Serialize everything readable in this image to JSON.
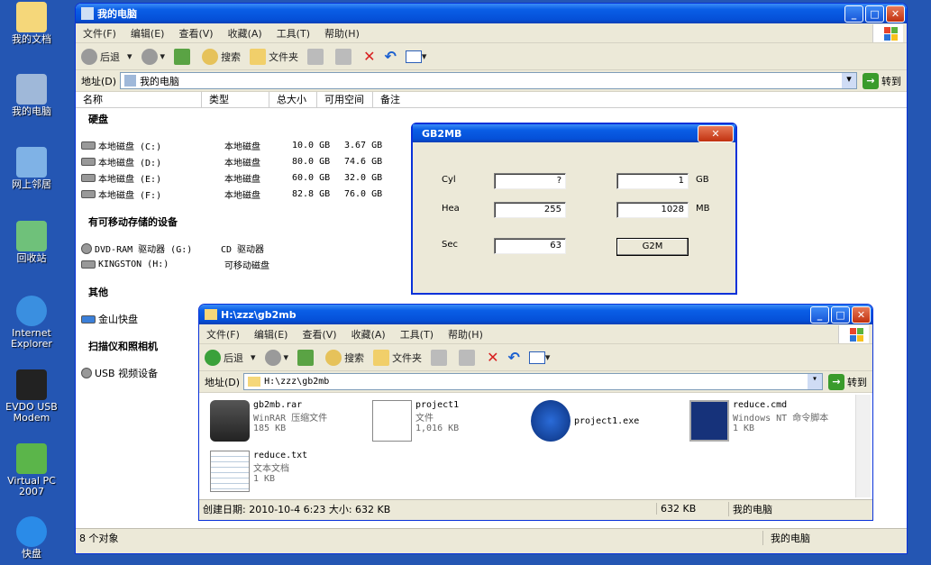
{
  "desktop": {
    "icons": [
      {
        "label": "我的文档"
      },
      {
        "label": "我的电脑"
      },
      {
        "label": "网上邻居"
      },
      {
        "label": "回收站"
      },
      {
        "label": "Internet Explorer"
      },
      {
        "label": "EVDO USB Modem"
      },
      {
        "label": "Virtual PC 2007"
      },
      {
        "label": "快盘"
      }
    ]
  },
  "main": {
    "title": "我的电脑",
    "menu": [
      "文件(F)",
      "编辑(E)",
      "查看(V)",
      "收藏(A)",
      "工具(T)",
      "帮助(H)"
    ],
    "toolbar": {
      "back": "后退",
      "search": "搜索",
      "folders": "文件夹"
    },
    "address": {
      "label": "地址(D)",
      "value": "我的电脑",
      "go": "转到"
    },
    "columns": [
      "名称",
      "类型",
      "总大小",
      "可用空间",
      "备注"
    ],
    "groups": {
      "hdd": "硬盘",
      "removable": "有可移动存储的设备",
      "other": "其他",
      "scanner": "扫描仪和照相机"
    },
    "drives": [
      {
        "name": "本地磁盘 (C:)",
        "type": "本地磁盘",
        "total": "10.0 GB",
        "free": "3.67 GB"
      },
      {
        "name": "本地磁盘 (D:)",
        "type": "本地磁盘",
        "total": "80.0 GB",
        "free": "74.6 GB"
      },
      {
        "name": "本地磁盘 (E:)",
        "type": "本地磁盘",
        "total": "60.0 GB",
        "free": "32.0 GB"
      },
      {
        "name": "本地磁盘 (F:)",
        "type": "本地磁盘",
        "total": "82.8 GB",
        "free": "76.0 GB"
      }
    ],
    "removable": [
      {
        "name": "DVD-RAM 驱动器 (G:)",
        "type": "CD 驱动器"
      },
      {
        "name": "KINGSTON (H:)",
        "type": "可移动磁盘"
      }
    ],
    "other": [
      {
        "name": "金山快盘"
      }
    ],
    "scanner": [
      {
        "name": "USB 视频设备"
      }
    ],
    "status": {
      "count": "8 个对象",
      "location": "我的电脑"
    }
  },
  "dialog": {
    "title": "GB2MB",
    "labels": {
      "cyl": "Cyl",
      "hea": "Hea",
      "sec": "Sec",
      "gb": "GB",
      "mb": "MB"
    },
    "values": {
      "cyl": "?",
      "hea": "255",
      "sec": "63",
      "gb": "1",
      "mb": "1028"
    },
    "button": "G2M"
  },
  "sub": {
    "title": "H:\\zzz\\gb2mb",
    "menu": [
      "文件(F)",
      "编辑(E)",
      "查看(V)",
      "收藏(A)",
      "工具(T)",
      "帮助(H)"
    ],
    "toolbar": {
      "back": "后退",
      "search": "搜索",
      "folders": "文件夹"
    },
    "address": {
      "label": "地址(D)",
      "value": "H:\\zzz\\gb2mb",
      "go": "转到"
    },
    "files": [
      {
        "name": "gb2mb.rar",
        "type": "WinRAR 压缩文件",
        "size": "185 KB"
      },
      {
        "name": "project1",
        "type": "文件",
        "size": "1,016 KB"
      },
      {
        "name": "project1.exe",
        "type": "",
        "size": ""
      },
      {
        "name": "reduce.cmd",
        "type": "Windows NT 命令脚本",
        "size": "1 KB"
      },
      {
        "name": "reduce.txt",
        "type": "文本文档",
        "size": "1 KB"
      }
    ],
    "status": {
      "info": "创建日期: 2010-10-4 6:23 大小: 632 KB",
      "size": "632 KB",
      "location": "我的电脑"
    }
  }
}
